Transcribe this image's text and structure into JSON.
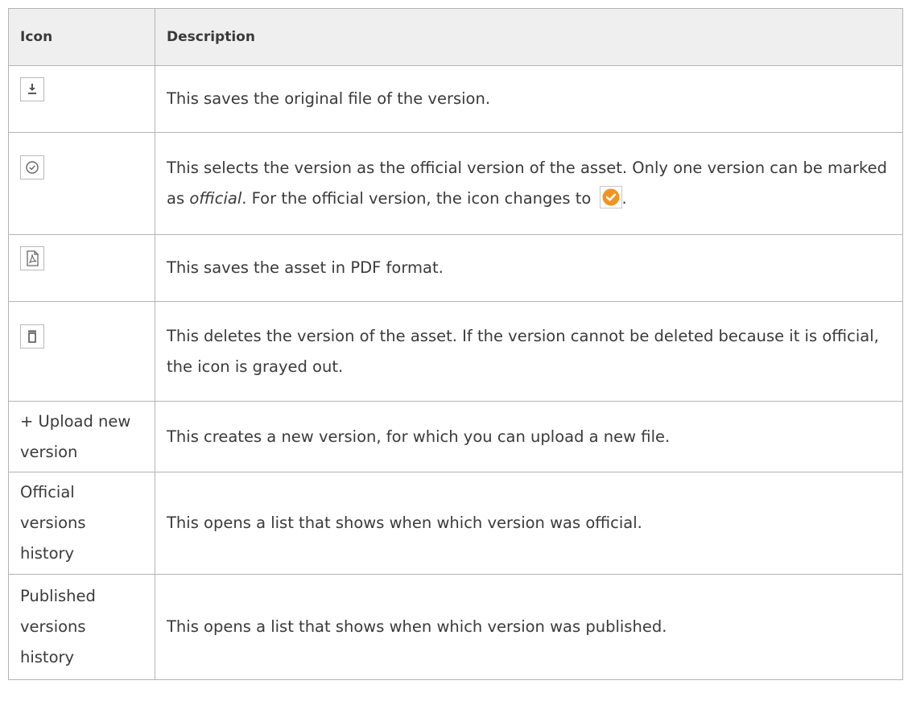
{
  "table": {
    "headers": [
      "Icon",
      "Description"
    ],
    "rows": [
      {
        "icon": "download-icon",
        "description": "This saves the original file of the version."
      },
      {
        "icon": "checkmark-circle-icon",
        "description_part1": "This selects the version as the official version of the asset. Only one version can be marked as ",
        "description_italic": "official",
        "description_part2": ". For the official version, the icon changes to ",
        "description_end": ".",
        "badge_icon": "official-check-icon"
      },
      {
        "icon": "pdf-icon",
        "description": "This saves the asset in PDF format."
      },
      {
        "icon": "trash-icon",
        "description": "This deletes the version of the asset. If the version cannot be deleted because it is official, the icon is grayed out."
      },
      {
        "label": "+ Upload new version",
        "description": "This creates a new version, for which you can upload a new file."
      },
      {
        "label": "Official versions history",
        "description": "This opens a list that shows when which version was official."
      },
      {
        "label": "Published versions history",
        "description": "This opens a list that shows when which version was published."
      }
    ]
  },
  "colors": {
    "border": "#b4b4b4",
    "header_bg": "#efefef",
    "official_orange": "#f29422"
  }
}
